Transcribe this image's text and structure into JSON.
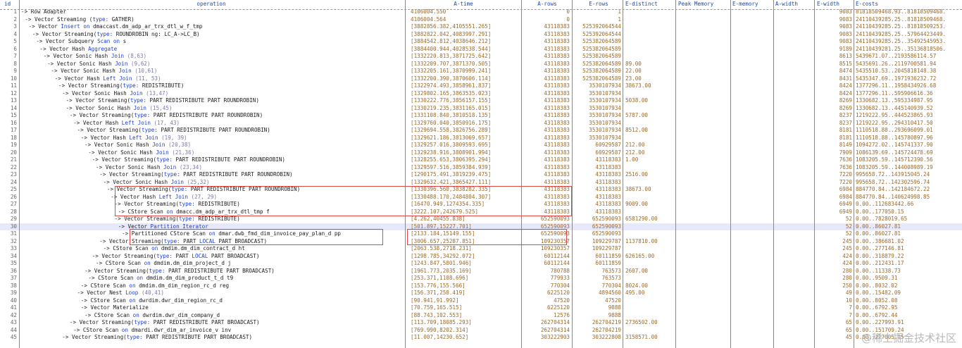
{
  "columns": {
    "id": "id",
    "operation": "operation",
    "a_time": "A-time",
    "a_rows": "A-rows",
    "e_rows": "E-rows",
    "e_distinct": "E-distinct",
    "peak_memory": "Peak Memory",
    "e_memory": "E-memory",
    "a_width": "A-width",
    "e_width": "E-width",
    "e_costs": "E-costs"
  },
  "rows": [
    {
      "id": "1",
      "ind": 0,
      "op": [
        [
          "->",
          0
        ],
        [
          " Row Adapter",
          0
        ]
      ],
      "at": "4106004.550",
      "ar": "0",
      "er": "1",
      "ed": "",
      "ew": "9083",
      "ec": "81818509468.93..81818509468."
    },
    {
      "id": "2",
      "ind": 1,
      "op": [
        [
          "-> Vector Streaming (",
          0
        ],
        [
          "type:",
          1
        ],
        [
          " GATHER)",
          0
        ]
      ],
      "at": "4106004.564",
      "ar": "0",
      "er": "1",
      "ed": "",
      "ew": "9083",
      "ec": "24110439285.25..81818509468."
    },
    {
      "id": "3",
      "ind": 2,
      "op": [
        [
          "-> Vector ",
          0
        ],
        [
          "Insert on",
          1
        ],
        [
          " dmaccast.dm_adp_ar_trx_dtl_w_f_tmp",
          0
        ]
      ],
      "at": "[3882856.382,4105551.265]",
      "ar": "43118383",
      "er": "525392064544",
      "ed": "",
      "ew": "9083",
      "ec": "24110439285.25..81818509253."
    },
    {
      "id": "4",
      "ind": 3,
      "op": [
        [
          "-> Vector Streaming(",
          0
        ],
        [
          "type:",
          1
        ],
        [
          " ROUNDROBIN ng: LC_A->LC_B)",
          0
        ]
      ],
      "at": "[3882822.042,4083997.291]",
      "ar": "43118383",
      "er": "525392064544",
      "ed": "",
      "ew": "9083",
      "ec": "24110439285.25..57964423449."
    },
    {
      "id": "5",
      "ind": 4,
      "op": [
        [
          "-> Vector Subquery ",
          0
        ],
        [
          "Scan on",
          1
        ],
        [
          " s",
          0
        ]
      ],
      "at": "[3884542.812,4038646.212]",
      "ar": "43118383",
      "er": "525382064589",
      "ed": "",
      "ew": "9083",
      "ec": "24110439285.25..35492545953."
    },
    {
      "id": "6",
      "ind": 5,
      "op": [
        [
          "-> Vector Hash ",
          0
        ],
        [
          "Aggregate",
          1
        ]
      ],
      "at": "[3884400.944,4028538.544]",
      "ar": "43118383",
      "er": "525382064589",
      "ed": "",
      "ew": "9189",
      "ec": "24110439281.25..35136818506."
    },
    {
      "id": "7",
      "ind": 6,
      "op": [
        [
          "-> Vector Sonic Hash ",
          0
        ],
        [
          "Join",
          1
        ],
        [
          " (8,63)",
          2
        ]
      ],
      "at": "[1332220.813,3871725.642]",
      "ar": "43118383",
      "er": "525382064589",
      "ed": "",
      "ew": "8613",
      "ec": "5439671.07..2193586114.57"
    },
    {
      "id": "8",
      "ind": 7,
      "op": [
        [
          "-> Vector Sonic Hash ",
          0
        ],
        [
          "Join",
          1
        ],
        [
          " (9,62)",
          2
        ]
      ],
      "at": "[1332209.707,3871370.505]",
      "ar": "43118383",
      "er": "525382064589",
      "ed": "89.00",
      "ew": "8515",
      "ec": "5435691.26..2119700581.94"
    },
    {
      "id": "9",
      "ind": 8,
      "op": [
        [
          "-> Vector Sonic Hash ",
          0
        ],
        [
          "Join",
          1
        ],
        [
          " (10,61)",
          2
        ]
      ],
      "at": "[1332205.161,3870999.241]",
      "ar": "43118383",
      "er": "525382064589",
      "ed": "22.00",
      "ew": "8474",
      "ec": "5435510.53..2045818148.38"
    },
    {
      "id": "10",
      "ind": 9,
      "op": [
        [
          "-> Vector Hash ",
          0
        ],
        [
          "Left Join",
          1
        ],
        [
          " (11, 53)",
          2
        ]
      ],
      "at": "[1332200.390,3870606.114]",
      "ar": "43118383",
      "er": "525382064589",
      "ed": "23.00",
      "ew": "8431",
      "ec": "5435347.69..1971936232.72"
    },
    {
      "id": "11",
      "ind": 10,
      "op": [
        [
          "-> Vector Streaming(",
          0
        ],
        [
          "type:",
          1
        ],
        [
          " REDISTRIBUTE)",
          0
        ]
      ],
      "at": "[1322974.493,3858961.837]",
      "ar": "43118383",
      "er": "3530107934",
      "ed": "38673.00",
      "ew": "8424",
      "ec": "1377296.11..1958434926.68"
    },
    {
      "id": "12",
      "ind": 11,
      "op": [
        [
          "-> Vector Sonic Hash ",
          0
        ],
        [
          "Join",
          1
        ],
        [
          " (13,47)",
          2
        ]
      ],
      "at": "[1329802.165,3863535.023]",
      "ar": "43118383",
      "er": "3530107934",
      "ed": "",
      "ew": "8424",
      "ec": "1377296.11..595906616.36"
    },
    {
      "id": "13",
      "ind": 12,
      "op": [
        [
          "-> Vector Streaming(",
          0
        ],
        [
          "type:",
          1
        ],
        [
          " PART REDISTRIBUTE PART ROUNDROBIN)",
          0
        ]
      ],
      "at": "[1330222.776,3856157.155]",
      "ar": "43118383",
      "er": "3530107934",
      "ed": "5038.00",
      "ew": "8269",
      "ec": "1330682.13..595334987.95"
    },
    {
      "id": "14",
      "ind": 12,
      "op": [
        [
          "-> Vector Sonic Hash ",
          0
        ],
        [
          "Join",
          1
        ],
        [
          " (15,45)",
          2
        ]
      ],
      "at": "[1330219.235,3831165.015]",
      "ar": "43118383",
      "er": "3530107934",
      "ed": "",
      "ew": "8269",
      "ec": "1330682.13..445140939.52"
    },
    {
      "id": "15",
      "ind": 13,
      "op": [
        [
          "-> Vector Streaming(",
          0
        ],
        [
          "type:",
          1
        ],
        [
          " PART REDISTRIBUTE PART ROUNDROBIN)",
          0
        ]
      ],
      "at": "[1331108.840,3810518.135]",
      "ar": "43118383",
      "er": "3530107934",
      "ed": "5787.00",
      "ew": "8237",
      "ec": "1219222.95..444523865.93"
    },
    {
      "id": "16",
      "ind": 14,
      "op": [
        [
          "-> Vector Hash ",
          0
        ],
        [
          "Left Join",
          1
        ],
        [
          " (17, 43)",
          2
        ]
      ],
      "at": "[1329760.040,3850916.175]",
      "ar": "43118383",
      "er": "3530107934",
      "ed": "",
      "ew": "8237",
      "ec": "1219222.95..294310417.50"
    },
    {
      "id": "17",
      "ind": 15,
      "op": [
        [
          "-> Vector Streaming(",
          0
        ],
        [
          "type:",
          1
        ],
        [
          " PART REDISTRIBUTE PART ROUNDROBIN)",
          0
        ]
      ],
      "at": "[1329694.558,3826756.289]",
      "ar": "43118383",
      "er": "3530107934",
      "ed": "8512.00",
      "ew": "8181",
      "ec": "1110518.88..293696099.01"
    },
    {
      "id": "18",
      "ind": 16,
      "op": [
        [
          "-> Vector Hash ",
          0
        ],
        [
          "Left Join",
          1
        ],
        [
          " (19, 39)",
          2
        ]
      ],
      "at": "[1329621.186,3813069.657]",
      "ar": "43118383",
      "er": "3530107934",
      "ed": "",
      "ew": "8181",
      "ec": "1110518.88..145780897.96"
    },
    {
      "id": "19",
      "ind": 17,
      "op": [
        [
          "-> Vector Sonic Hash ",
          0
        ],
        [
          "Join",
          1
        ],
        [
          " (20,38)",
          2
        ]
      ],
      "at": "[1329257.016,3809593.695]",
      "ar": "43118383",
      "er": "60929587",
      "ed": "212.00",
      "ew": "8149",
      "ec": "1094272.02..145741337.90"
    },
    {
      "id": "20",
      "ind": 18,
      "op": [
        [
          "-> Vector Sonic Hash ",
          0
        ],
        [
          "Join",
          1
        ],
        [
          " (21,36)",
          2
        ]
      ],
      "at": "[1329238.916,3808901.994]",
      "ar": "43118383",
      "er": "60929587",
      "ed": "212.00",
      "ew": "7909",
      "ec": "1086139.69..145724478.69"
    },
    {
      "id": "21",
      "ind": 19,
      "op": [
        [
          "-> Vector Streaming(",
          0
        ],
        [
          "type:",
          1
        ],
        [
          " PART REDISTRIBUTE PART ROUNDROBIN)",
          0
        ]
      ],
      "at": "[1328255.653,3806395.294]",
      "ar": "43118383",
      "er": "43118383",
      "ed": "1.00",
      "ew": "7636",
      "ec": "1083205.59..145712390.56"
    },
    {
      "id": "22",
      "ind": 20,
      "op": [
        [
          "-> Vector Sonic Hash ",
          0
        ],
        [
          "Join",
          1
        ],
        [
          " (23,34)",
          2
        ]
      ],
      "at": "[1329597.516,3859384.939]",
      "ar": "43118383",
      "er": "43118383",
      "ed": "",
      "ew": "7636",
      "ec": "1083205.59..144008989.19"
    },
    {
      "id": "23",
      "ind": 21,
      "op": [
        [
          "-> Vector Streaming(",
          0
        ],
        [
          "type:",
          1
        ],
        [
          " PART REDISTRIBUTE PART ROUNDROBIN)",
          0
        ]
      ],
      "at": "[1290175.491,3819239.475]",
      "ar": "43118383",
      "er": "43118383",
      "ed": "2516.00",
      "ew": "7220",
      "ec": "995658.72..143915045.24"
    },
    {
      "id": "24",
      "ind": 22,
      "op": [
        [
          "-> Vector Sonic Hash ",
          0
        ],
        [
          "Join",
          1
        ],
        [
          " (25,32)",
          2
        ]
      ],
      "at": "[1329632.421,3865427.111]",
      "ar": "43118383",
      "er": "43118383",
      "ed": "",
      "ew": "7220",
      "ec": "995658.72..142302596.74"
    },
    {
      "id": "25",
      "ind": 23,
      "op": [
        [
          "-> Vector Streaming(",
          0
        ],
        [
          "type:",
          1
        ],
        [
          " PART REDISTRIBUTE PART ROUNDROBIN)",
          0
        ]
      ],
      "at": "[1330396.560,3838282.335]",
      "ar": "43118383",
      "er": "43118383",
      "ed": "38673.00",
      "ew": "6984",
      "ec": "884770.84..142184672.22"
    },
    {
      "id": "26",
      "ind": 24,
      "op": [
        [
          "-> Vector Hash ",
          0
        ],
        [
          "Left Join",
          1
        ],
        [
          " (27, 29)",
          2
        ]
      ],
      "at": "[1330488.170,2484804.307]",
      "ar": "43118383",
      "er": "43118383",
      "ed": "",
      "ew": "6984",
      "ec": "884770.84..140624998.85"
    },
    {
      "id": "27",
      "ind": 25,
      "op": [
        [
          "-> Vector Streaming(",
          0
        ],
        [
          "type:",
          1
        ],
        [
          " REDISTRIBUTE)",
          0
        ]
      ],
      "at": "[16470.949,1274354.335]",
      "ar": "43118383",
      "er": "43118383",
      "ed": "9009.00",
      "ew": "6949",
      "ec": "0.00..112683442.66"
    },
    {
      "id": "28",
      "ind": 26,
      "op": [
        [
          "-> CStore Scan ",
          0
        ],
        [
          "on",
          1
        ],
        [
          " dmacc.dm_adp_ar_trx_dtl_tmp f",
          0
        ]
      ],
      "at": "[3222.107,242679.525]",
      "ar": "43118383",
      "er": "43118383",
      "ed": "",
      "ew": "6949",
      "ec": "0.00..177050.15"
    },
    {
      "id": "29",
      "ind": 25,
      "op": [
        [
          "-> Vector Streaming(",
          0
        ],
        [
          "type:",
          1
        ],
        [
          " REDISTRIBUTE)",
          0
        ]
      ],
      "at": "[4.262,40455.838]",
      "ar": "652590093",
      "er": "652590093",
      "ed": "6581290.00",
      "ew": "52",
      "ec": "0.00..7828019.65"
    },
    {
      "id": "30",
      "ind": 26,
      "op": [
        [
          "-> Vector ",
          0
        ],
        [
          "Partition Iterator",
          1
        ]
      ],
      "at": "[501.897,15227.701]",
      "ar": "652590093",
      "er": "652590093",
      "ed": "",
      "ew": "52",
      "ec": "0.00..86027.81",
      "hl": true
    },
    {
      "id": "31",
      "ind": 27,
      "op": [
        [
          "-> Partitioned CStore Scan ",
          0
        ],
        [
          "on",
          1
        ],
        [
          " dmar.dwb_fmd_dim_invoice_pay_plan_d pp",
          0
        ]
      ],
      "at": "[2133.184,15149.155]",
      "ar": "652590093",
      "er": "652590093",
      "ed": "",
      "ew": "52",
      "ec": "0.00..86027.81"
    },
    {
      "id": "32",
      "ind": 21,
      "op": [
        [
          "-> Vector Streaming(",
          0
        ],
        [
          "type:",
          1
        ],
        [
          " PART ",
          0
        ],
        [
          "LOCAL",
          1
        ],
        [
          " PART BROADCAST)",
          0
        ]
      ],
      "at": "[3006.657,25287.851]",
      "ar": "109230357",
      "er": "109229787",
      "ed": "1137810.00",
      "ew": "245",
      "ec": "0.00..386681.02"
    },
    {
      "id": "33",
      "ind": 22,
      "op": [
        [
          "-> CStore Scan ",
          0
        ],
        [
          "on",
          1
        ],
        [
          " dmdim.dm_dim_contract_d ht",
          0
        ]
      ],
      "at": "[2063.538,2718.231]",
      "ar": "109230357",
      "er": "109229787",
      "ed": "",
      "ew": "245",
      "ec": "0.00..277146.81"
    },
    {
      "id": "34",
      "ind": 19,
      "op": [
        [
          "-> Vector Streaming(",
          0
        ],
        [
          "type:",
          1
        ],
        [
          " PART ",
          0
        ],
        [
          "LOCAL",
          1
        ],
        [
          " PART BROADCAST)",
          0
        ]
      ],
      "at": "[1298.785,34292.072]",
      "ar": "60112144",
      "er": "60111859",
      "ed": "626165.00",
      "ew": "424",
      "ec": "0.00..318879.22"
    },
    {
      "id": "35",
      "ind": 20,
      "op": [
        [
          "-> CStore Scan ",
          0
        ],
        [
          "on",
          1
        ],
        [
          " dmdim.dm_dim_project_d j",
          0
        ]
      ],
      "at": "[1243.847,5801.946]",
      "ar": "60112144",
      "er": "60111859",
      "ed": "",
      "ew": "424",
      "ec": "0.00..212431.17"
    },
    {
      "id": "36",
      "ind": 17,
      "op": [
        [
          "-> Vector Streaming(",
          0
        ],
        [
          "type:",
          1
        ],
        [
          " PART REDISTRIBUTE PART BROADCAST)",
          0
        ]
      ],
      "at": "[1961.773,2035.169]",
      "ar": "780788",
      "er": "763573",
      "ed": "2607.00",
      "ew": "280",
      "ec": "0.00..11338.73"
    },
    {
      "id": "37",
      "ind": 18,
      "op": [
        [
          "-> CStore Scan ",
          0
        ],
        [
          "on",
          1
        ],
        [
          " dmdim.dm_dim_product_t_d t9",
          0
        ]
      ],
      "at": "[253.371,1108.696]",
      "ar": "779933",
      "er": "763573",
      "ed": "",
      "ew": "280",
      "ec": "0.00..9509.31"
    },
    {
      "id": "38",
      "ind": 16,
      "op": [
        [
          "-> CStore Scan ",
          0
        ],
        [
          "on",
          1
        ],
        [
          " dmdim.dm_dim_region_rc_d reg",
          0
        ]
      ],
      "at": "[153.776,155.566]",
      "ar": "770304",
      "er": "770304",
      "ed": "8024.00",
      "ew": "250",
      "ec": "0.00..8032.02"
    },
    {
      "id": "39",
      "ind": 15,
      "op": [
        [
          "-> Vector Nest ",
          0
        ],
        [
          "Loop",
          1
        ],
        [
          " (40,41)",
          2
        ]
      ],
      "at": "[156.371,258.419]",
      "ar": "6225120",
      "er": "4894560",
      "ed": "495.00",
      "ew": "49",
      "ec": "0.00..15482.09"
    },
    {
      "id": "40",
      "ind": 16,
      "op": [
        [
          "-> CStore Scan ",
          0
        ],
        [
          "on",
          1
        ],
        [
          " dwrdim.dwr_dim_region_rc_d",
          0
        ]
      ],
      "at": "[90.941,91.992]",
      "ar": "47520",
      "er": "47520",
      "ed": "",
      "ew": "10",
      "ec": "0.00..8052.08"
    },
    {
      "id": "41",
      "ind": 16,
      "op": [
        [
          "-> Vector Materialize",
          0
        ]
      ],
      "at": "[70.759,165.515]",
      "ar": "6225120",
      "er": "9888",
      "ed": "",
      "ew": "7",
      "ec": "0.00..6792.95"
    },
    {
      "id": "42",
      "ind": 17,
      "op": [
        [
          "-> CStore Scan ",
          0
        ],
        [
          "on",
          1
        ],
        [
          " dwrdim.dwr_dim_company_d",
          0
        ]
      ],
      "at": "[88.743,102.553]",
      "ar": "12576",
      "er": "9888",
      "ed": "",
      "ew": "7",
      "ec": "0.00..6792.44"
    },
    {
      "id": "43",
      "ind": 13,
      "op": [
        [
          "-> Vector Streaming(",
          0
        ],
        [
          "type:",
          1
        ],
        [
          " PART REDISTRIBUTE PART BROADCAST)",
          0
        ]
      ],
      "at": "[113.709,18085.293]",
      "ar": "262704314",
      "er": "262704219",
      "ed": "2736502.00",
      "ew": "65",
      "ec": "0.00..227993.91"
    },
    {
      "id": "44",
      "ind": 14,
      "op": [
        [
          "-> CStore Scan ",
          0
        ],
        [
          "on",
          1
        ],
        [
          " dmardi.dwr_dim_ar_invoice_v inv",
          0
        ]
      ],
      "at": "[769.990,8202.314]",
      "ar": "262704314",
      "er": "262704219",
      "ed": "",
      "ew": "65",
      "ec": "0.00..151709.24"
    },
    {
      "id": "45",
      "ind": 11,
      "op": [
        [
          "-> Vector Streaming(",
          0
        ],
        [
          "type:",
          1
        ],
        [
          " PART REDISTRIBUTE PART BROADCAST)",
          0
        ]
      ],
      "at": "[11.007,14230.652]",
      "ar": "303222903",
      "er": "303222808",
      "ed": "3158571.00",
      "ew": "45",
      "ec": "0.00..217005.15"
    }
  ],
  "highlight_color": "#e04848",
  "keyword_color": "#1d3fcf",
  "value_color": "#9b6a2a",
  "watermark": "@稀土掘金技术社区"
}
